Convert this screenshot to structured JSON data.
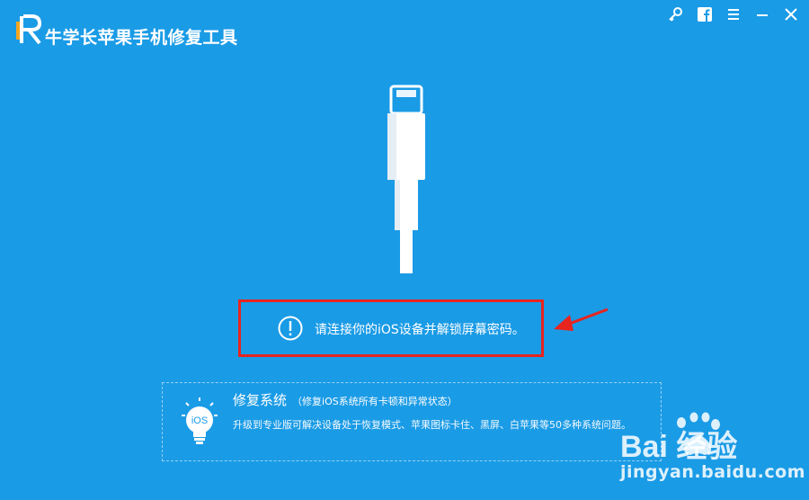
{
  "window": {
    "title": "牛学长苹果手机修复工具",
    "controls": [
      {
        "name": "key-icon",
        "glyph": "🔑"
      },
      {
        "name": "facebook-icon",
        "glyph": "f"
      },
      {
        "name": "menu-icon",
        "glyph": "≡"
      },
      {
        "name": "minimize-icon",
        "glyph": "—"
      },
      {
        "name": "close-icon",
        "glyph": "✕"
      }
    ]
  },
  "connect": {
    "message": "请连接你的iOS设备并解锁屏幕密码。"
  },
  "repair": {
    "title": "修复系统",
    "subtitle": "（修复iOS系统所有卡顿和异常状态）",
    "description": "升级到专业版可解决设备处于恢复模式、苹果图标卡住、黑屏、白苹果等50多种系统问题。",
    "badge": "iOS"
  },
  "watermark": {
    "logo": "Bai 经验",
    "url": "jingyan.baidu.com"
  },
  "colors": {
    "background": "#1a9be6",
    "highlight": "#e8241f",
    "text": "#ffffff"
  }
}
